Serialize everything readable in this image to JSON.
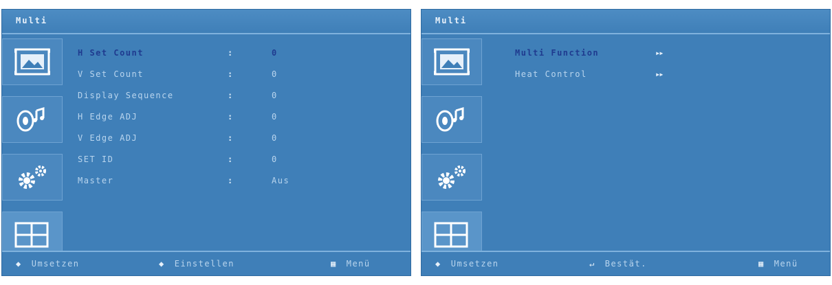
{
  "screens": [
    {
      "title": "Multi",
      "rows": [
        {
          "label": "H Set Count",
          "colon": ":",
          "value": "0",
          "selected": true
        },
        {
          "label": "V Set Count",
          "colon": ":",
          "value": "0"
        },
        {
          "label": "Display Sequence",
          "colon": ":",
          "value": "0"
        },
        {
          "label": "H Edge ADJ",
          "colon": ":",
          "value": "0"
        },
        {
          "label": "V Edge ADJ",
          "colon": ":",
          "value": "0"
        },
        {
          "label": "SET ID",
          "colon": ":",
          "value": "0"
        },
        {
          "label": "Master",
          "colon": ":",
          "value": "Aus"
        }
      ],
      "footer": [
        {
          "icon_glyph": "◆",
          "icon_name": "up-down-icon",
          "label": "Umsetzen"
        },
        {
          "icon_glyph": "◆",
          "icon_name": "left-right-icon",
          "label": "Einstellen"
        },
        {
          "icon_glyph": "▦",
          "icon_name": "menu-icon",
          "label": "Menü"
        }
      ]
    },
    {
      "title": "Multi",
      "rows": [
        {
          "label": "Multi Function",
          "colon": "",
          "value": "▸▸",
          "selected": true
        },
        {
          "label": "Heat Control",
          "colon": "",
          "value": "▸▸"
        }
      ],
      "footer": [
        {
          "icon_glyph": "◆",
          "icon_name": "up-down-icon",
          "label": "Umsetzen"
        },
        {
          "icon_glyph": "↵",
          "icon_name": "enter-icon",
          "label": "Bestät."
        },
        {
          "icon_glyph": "▦",
          "icon_name": "menu-icon",
          "label": "Menü"
        }
      ]
    }
  ],
  "sidebar_icons": [
    "picture-icon",
    "sound-icon",
    "settings-gears-icon",
    "multi-screen-grid-icon"
  ],
  "colors": {
    "background": "#3f7fb8",
    "text": "#b9d5ee",
    "selected_text": "#1f3b8f",
    "border": "#7fb2dd"
  }
}
